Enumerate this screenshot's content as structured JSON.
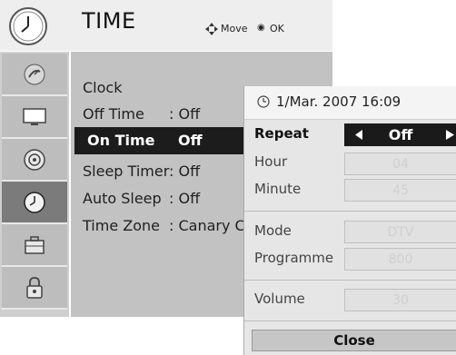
{
  "header": {
    "title": "TIME",
    "move_label": "Move",
    "ok_label": "OK",
    "ok_icon": "◉"
  },
  "sidebar": {
    "items": [
      {
        "icon": "satellite-dish-icon"
      },
      {
        "icon": "monitor-icon"
      },
      {
        "icon": "speaker-icon"
      },
      {
        "icon": "clock-icon",
        "active": true
      },
      {
        "icon": "briefcase-icon"
      },
      {
        "icon": "lock-icon"
      }
    ]
  },
  "menu": {
    "items": [
      {
        "label": "Clock",
        "value": ""
      },
      {
        "label": "Off Time",
        "value": ": Off"
      },
      {
        "label": "On Time",
        "value": "Off"
      },
      {
        "label": "Sleep Timer",
        "value": ": Off"
      },
      {
        "label": "Auto Sleep",
        "value": ": Off"
      },
      {
        "label": "Time Zone",
        "value": ": Canary C"
      }
    ]
  },
  "popup": {
    "datetime": "1/Mar. 2007 16:09",
    "repeat_label": "Repeat",
    "repeat_value": "Off",
    "hour_label": "Hour",
    "hour_value": "04",
    "minute_label": "Minute",
    "minute_value": "45",
    "mode_label": "Mode",
    "mode_value": "DTV",
    "programme_label": "Programme",
    "programme_value": "800",
    "volume_label": "Volume",
    "volume_value": "30",
    "close_label": "Close"
  },
  "colors": {
    "highlight": "#1c1c1c",
    "menu_bg": "#c2c2c2",
    "sidebar_bg": "#cfcfcf",
    "popup_bg": "#e6e6e6"
  }
}
